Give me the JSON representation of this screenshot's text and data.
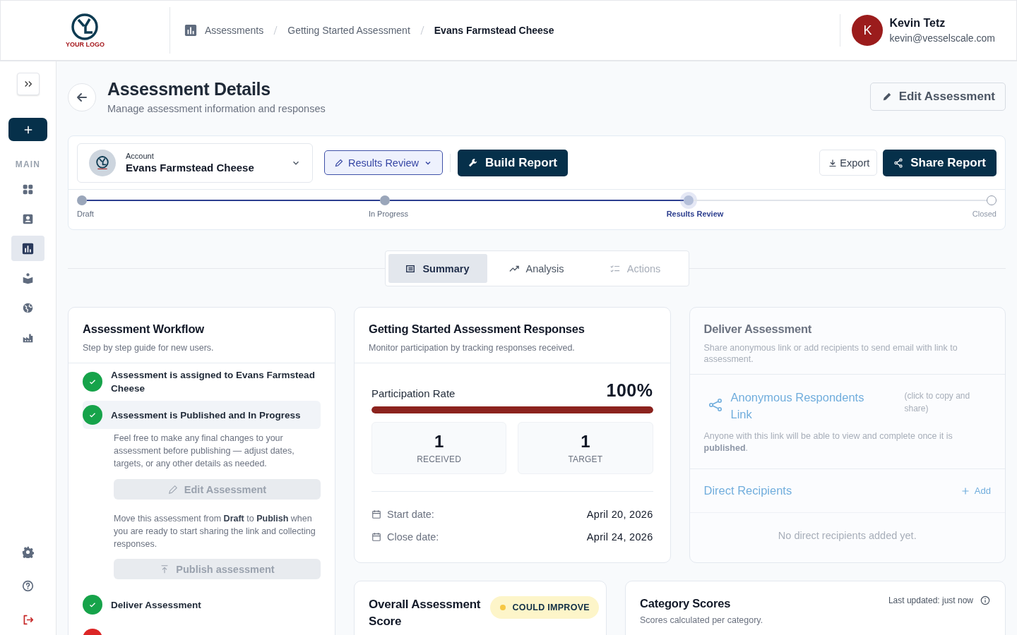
{
  "header": {
    "logo_text": "YOUR LOGO",
    "breadcrumbs": [
      {
        "label": "Assessments",
        "current": false
      },
      {
        "label": "Getting Started Assessment",
        "current": false
      },
      {
        "label": "Evans Farmstead Cheese",
        "current": true
      }
    ],
    "user": {
      "initial": "K",
      "name": "Kevin Tetz",
      "email": "kevin@vesselscale.com"
    }
  },
  "sidebar": {
    "section_label": "MAIN",
    "nav": [
      {
        "selected": false
      },
      {
        "selected": false
      },
      {
        "selected": true
      },
      {
        "selected": false
      },
      {
        "selected": false
      },
      {
        "selected": false
      }
    ]
  },
  "page": {
    "title": "Assessment Details",
    "subtitle": "Manage assessment information and responses",
    "edit_button": "Edit Assessment"
  },
  "toolbar": {
    "account": {
      "label": "Account",
      "name": "Evans Farmstead Cheese"
    },
    "status_button": "Results Review",
    "build_button": "Build Report",
    "export_button": "Export",
    "share_button": "Share Report"
  },
  "stages": [
    {
      "label": "Draft",
      "done": true,
      "selected": false
    },
    {
      "label": "In Progress",
      "done": true,
      "selected": false
    },
    {
      "label": "Results Review",
      "done": false,
      "selected": true
    },
    {
      "label": "Closed",
      "done": false,
      "selected": false
    }
  ],
  "tabs": [
    {
      "label": "Summary",
      "selected": true,
      "disabled": false
    },
    {
      "label": "Analysis",
      "selected": false,
      "disabled": false
    },
    {
      "label": "Actions",
      "selected": false,
      "disabled": true
    }
  ],
  "workflow": {
    "title": "Assessment Workflow",
    "subtitle": "Step by step guide for new users.",
    "steps": [
      {
        "title": "Assessment is assigned to Evans Farmstead Cheese",
        "done": true,
        "expanded": false
      },
      {
        "title": "Assessment is Published and In Progress",
        "done": true,
        "expanded": true,
        "blocks": [
          {
            "kind": "text",
            "text": "Feel free to make any final changes to your assessment before publishing — adjust dates, targets, or any other details as needed."
          },
          {
            "kind": "button",
            "label": "Edit Assessment",
            "disabled": true
          },
          {
            "kind": "text",
            "text": "Move this assessment from **Draft** to **Publish** when you are ready to start sharing the link and collecting responses."
          },
          {
            "kind": "button",
            "label": "Publish assessment",
            "disabled": true
          }
        ]
      },
      {
        "title": "Deliver Assessment",
        "done": true,
        "expanded": false
      },
      {
        "done": false,
        "expanded": false
      }
    ]
  },
  "responses": {
    "title": "Getting Started Assessment Responses",
    "subtitle": "Monitor participation by tracking responses received.",
    "rate_label": "Participation Rate",
    "rate_value": "100%",
    "level": 1,
    "stats": [
      {
        "value": "1",
        "label": "RECEIVED"
      },
      {
        "value": "1",
        "label": "TARGET"
      }
    ],
    "dates": [
      {
        "label": "Start date:",
        "value": "April 20, 2026"
      },
      {
        "label": "Close date:",
        "value": "April 24, 2026"
      }
    ]
  },
  "deliver": {
    "disabled": true,
    "title": "Deliver Assessment",
    "subtitle": "Share anonymous link or add recipients to send email with link to assessment.",
    "link_title": "Anonymous Respondents Link",
    "link_hint": "(click to copy and share)",
    "link_note": "Anyone with this link will be able to view and complete once it is **published**.",
    "recipients_title": "Direct Recipients",
    "add_button": "Add",
    "empty_text": "No direct recipients added yet."
  },
  "score": {
    "title": "Overall Assessment Score",
    "badge": "COULD IMPROVE"
  },
  "category": {
    "title": "Category Scores",
    "subtitle": "Scores calculated per category.",
    "updated": "Last updated: just now"
  }
}
